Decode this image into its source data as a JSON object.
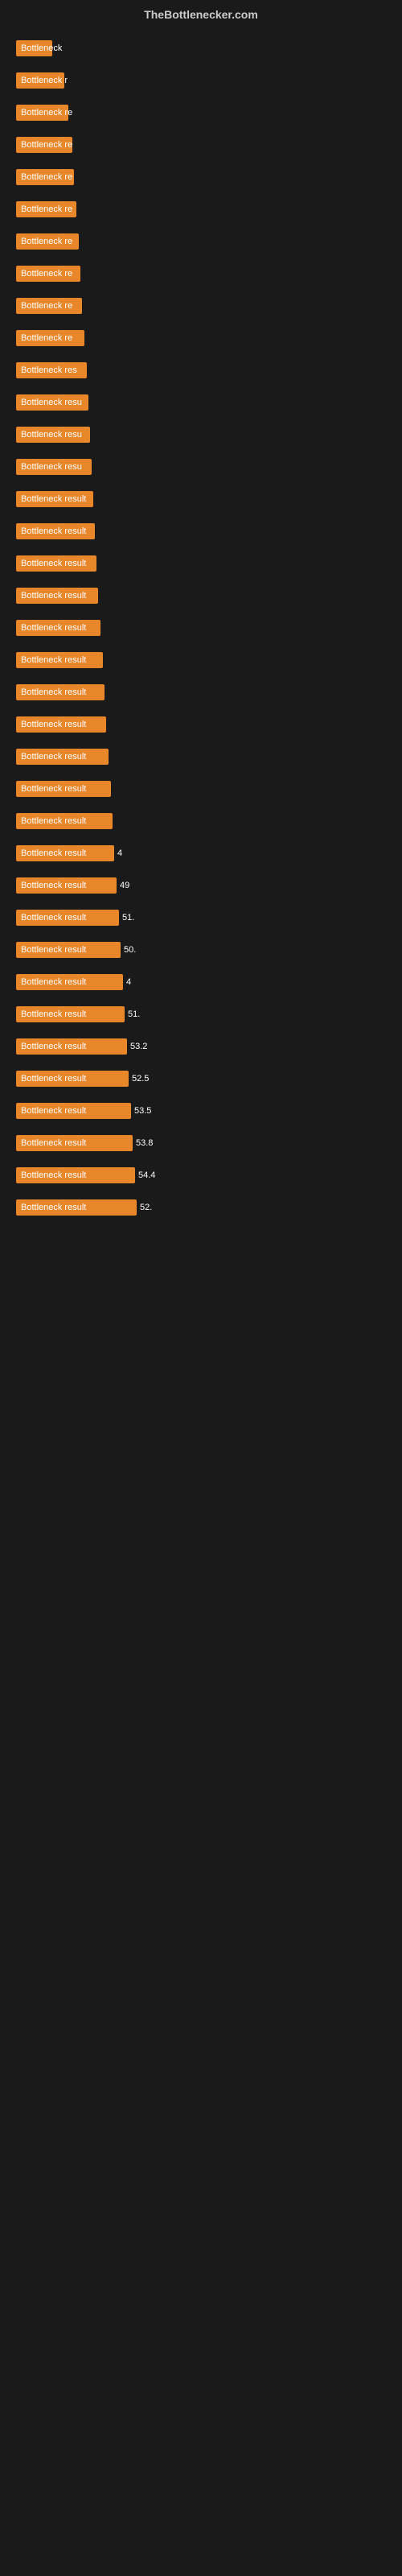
{
  "header": {
    "title": "TheBottlenecker.com"
  },
  "bars": [
    {
      "label": "Bottleneck",
      "value": "",
      "width": 45
    },
    {
      "label": "Bottleneck r",
      "value": "",
      "width": 60
    },
    {
      "label": "Bottleneck re",
      "value": "",
      "width": 65
    },
    {
      "label": "Bottleneck re",
      "value": "",
      "width": 70
    },
    {
      "label": "Bottleneck re",
      "value": "",
      "width": 72
    },
    {
      "label": "Bottleneck re",
      "value": "",
      "width": 75
    },
    {
      "label": "Bottleneck re",
      "value": "",
      "width": 78
    },
    {
      "label": "Bottleneck re",
      "value": "",
      "width": 80
    },
    {
      "label": "Bottleneck re",
      "value": "",
      "width": 82
    },
    {
      "label": "Bottleneck re",
      "value": "",
      "width": 85
    },
    {
      "label": "Bottleneck res",
      "value": "",
      "width": 88
    },
    {
      "label": "Bottleneck resu",
      "value": "",
      "width": 90
    },
    {
      "label": "Bottleneck resu",
      "value": "",
      "width": 92
    },
    {
      "label": "Bottleneck resu",
      "value": "",
      "width": 94
    },
    {
      "label": "Bottleneck result",
      "value": "",
      "width": 96
    },
    {
      "label": "Bottleneck result",
      "value": "",
      "width": 98
    },
    {
      "label": "Bottleneck result",
      "value": "",
      "width": 100
    },
    {
      "label": "Bottleneck result",
      "value": "",
      "width": 102
    },
    {
      "label": "Bottleneck result",
      "value": "",
      "width": 105
    },
    {
      "label": "Bottleneck result",
      "value": "",
      "width": 108
    },
    {
      "label": "Bottleneck result",
      "value": "",
      "width": 110
    },
    {
      "label": "Bottleneck result",
      "value": "",
      "width": 112
    },
    {
      "label": "Bottleneck result",
      "value": "",
      "width": 115
    },
    {
      "label": "Bottleneck result",
      "value": "",
      "width": 118
    },
    {
      "label": "Bottleneck result",
      "value": "",
      "width": 120
    },
    {
      "label": "Bottleneck result",
      "value": "4",
      "width": 122
    },
    {
      "label": "Bottleneck result",
      "value": "49",
      "width": 125
    },
    {
      "label": "Bottleneck result",
      "value": "51.",
      "width": 128
    },
    {
      "label": "Bottleneck result",
      "value": "50.",
      "width": 130
    },
    {
      "label": "Bottleneck result",
      "value": "4",
      "width": 133
    },
    {
      "label": "Bottleneck result",
      "value": "51.",
      "width": 135
    },
    {
      "label": "Bottleneck result",
      "value": "53.2",
      "width": 138
    },
    {
      "label": "Bottleneck result",
      "value": "52.5",
      "width": 140
    },
    {
      "label": "Bottleneck result",
      "value": "53.5",
      "width": 143
    },
    {
      "label": "Bottleneck result",
      "value": "53.8",
      "width": 145
    },
    {
      "label": "Bottleneck result",
      "value": "54.4",
      "width": 148
    },
    {
      "label": "Bottleneck result",
      "value": "52.",
      "width": 150
    }
  ]
}
